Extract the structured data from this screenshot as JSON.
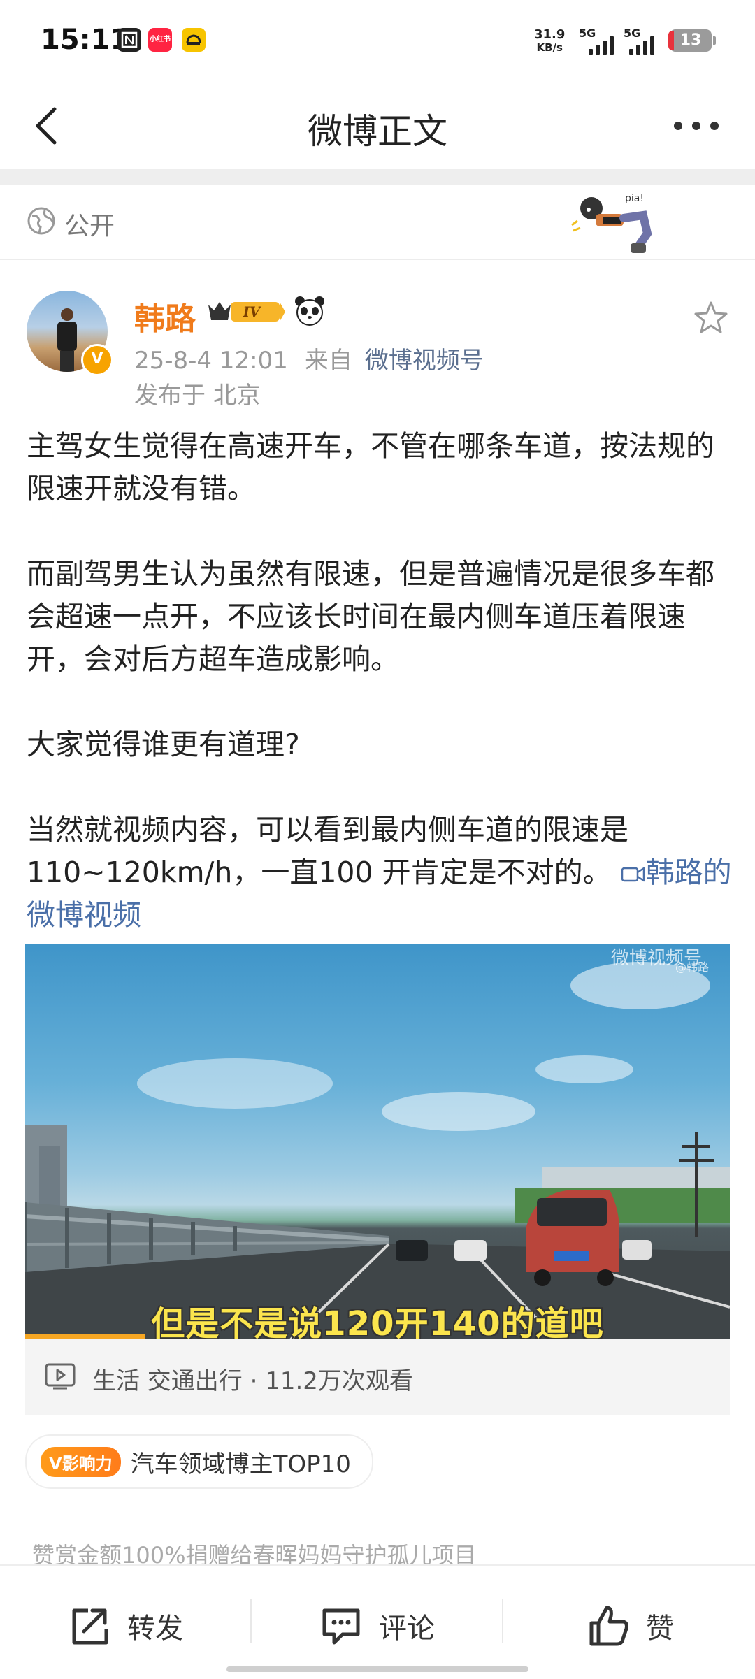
{
  "status_bar": {
    "time": "15:11",
    "app_icons": [
      "notion-icon",
      "xiaohongshu-icon",
      "car-app-icon"
    ],
    "xiaohongshu_label": "小红书",
    "net_speed_value": "31.9",
    "net_speed_unit": "KB/s",
    "signal_1": "5G",
    "signal_2": "5G",
    "battery": "13"
  },
  "nav": {
    "title": "微博正文",
    "back_icon": "chevron-left-icon",
    "more_icon": "more-dots-icon"
  },
  "visibility": {
    "label": "公开",
    "sticker_text": "pia!"
  },
  "author": {
    "name": "韩路",
    "rank_badge": "IV",
    "date": "25-8-4 12:01",
    "source_prefix": "来自",
    "source": "微博视频号",
    "location": "发布于 北京"
  },
  "post": {
    "p1": "主驾女生觉得在高速开车，不管在哪条车道，按法规的限速开就没有错。",
    "p2": "而副驾男生认为虽然有限速，但是普遍情况是很多车都会超速一点开，不应该长时间在最内侧车道压着限速开，会对后方超车造成影响。",
    "p3": "大家觉得谁更有道理?",
    "p4": "当然就视频内容，可以看到最内侧车道的限速是110~120km/h，一直100 开肯定是不对的。",
    "video_link": "韩路的微博视频"
  },
  "video": {
    "caption": "但是不是说120开140的道吧",
    "watermark": "微博视频号",
    "watermark_handle": "@韩路",
    "progress_fraction": 0.17,
    "info": "生活 交通出行 · 11.2万次观看"
  },
  "influence": {
    "badge": "V影响力",
    "text": "汽车领域博主TOP10"
  },
  "donate_text": "赞赏金额100%捐赠给春晖妈妈守护孤儿项目",
  "toolbar": {
    "repost": "转发",
    "comment": "评论",
    "like": "赞"
  },
  "colors": {
    "author_name": "#f07b1b",
    "link": "#4a6fa8",
    "caption": "#fbe54d"
  }
}
